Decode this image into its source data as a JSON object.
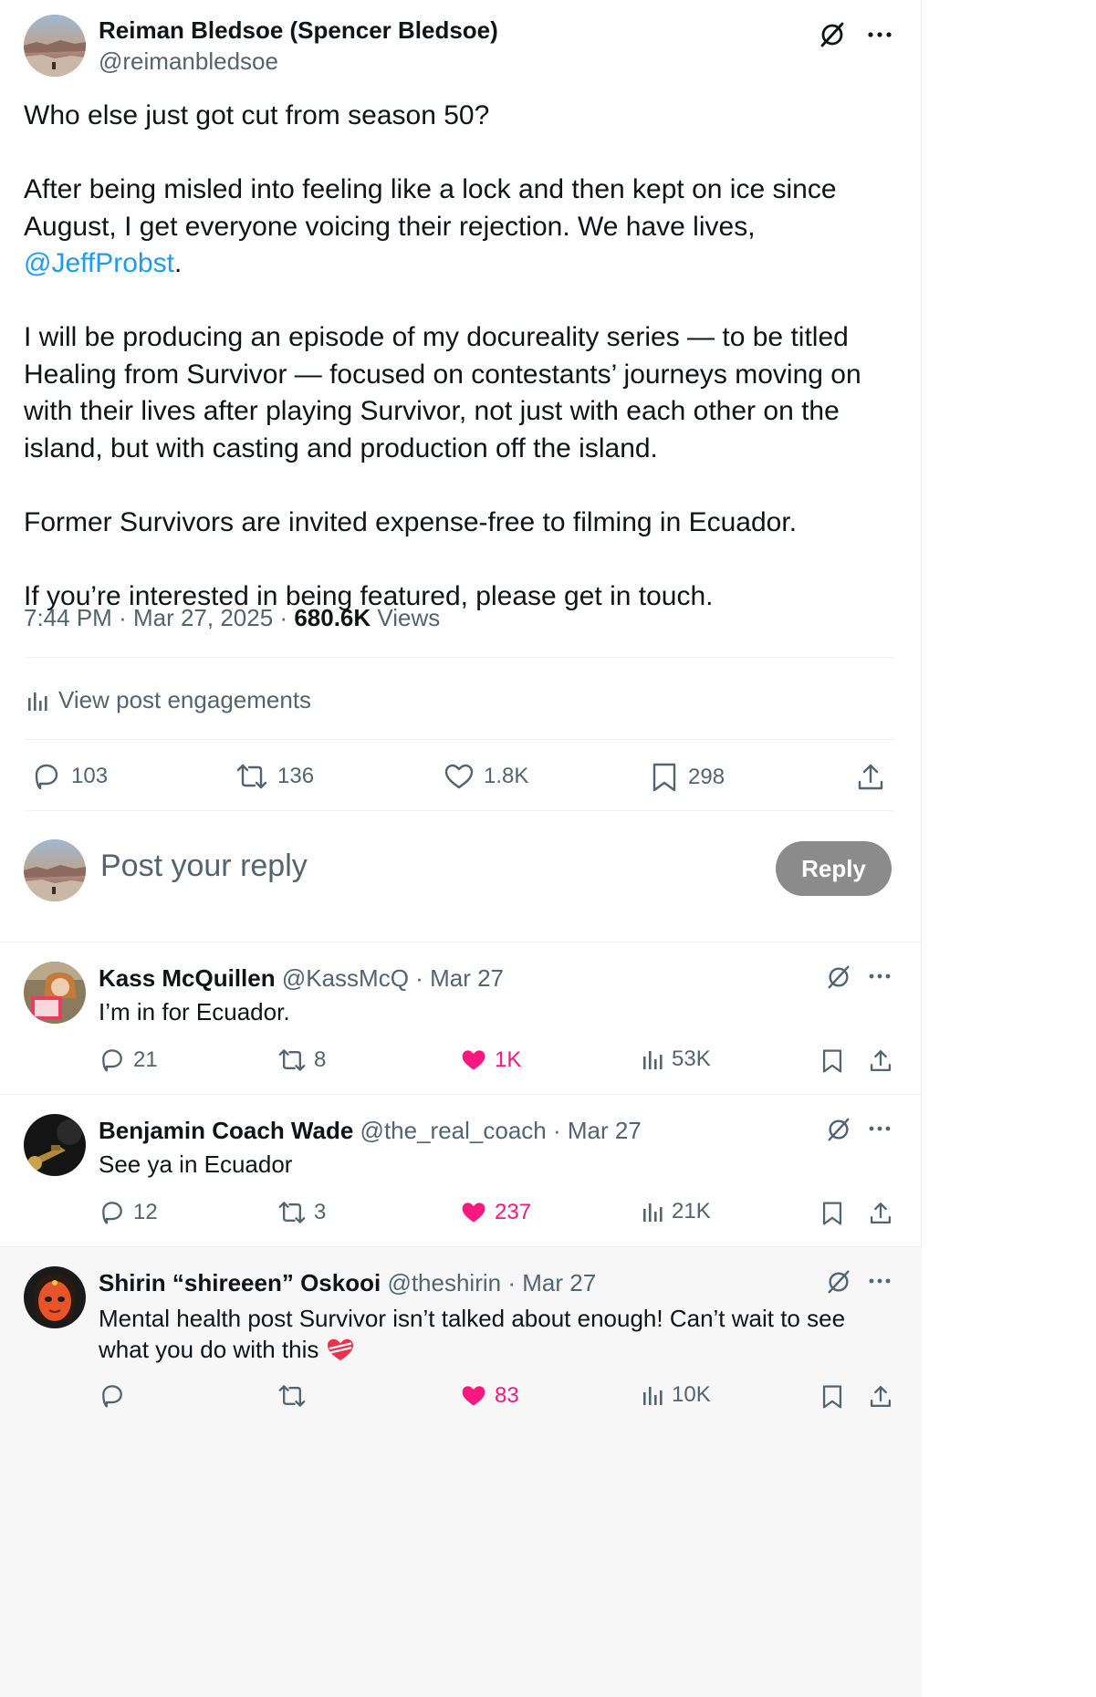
{
  "post": {
    "author_name": "Reiman Bledsoe (Spencer Bledsoe)",
    "author_handle": "@reimanbledsoe",
    "paragraphs": {
      "p1": "Who else just got cut from season 50?",
      "p2_line1": "After being misled into feeling like a lock and then kept on ice since",
      "p2_line2_pre": "August, I get everyone voicing their rejection. We have lives, ",
      "p2_mention": "@JeffProbst",
      "p2_line2_post": ".",
      "p3_line1": "I will be producing an episode of my docureality series — to be titled",
      "p3_line2": "Healing from Survivor — focused on contestants’ journeys moving on",
      "p3_line3": "with their lives after playing Survivor, not just with each other on the",
      "p3_line4": "island, but with casting and production off the island.",
      "p4": "Former Survivors are invited expense-free to filming in Ecuador.",
      "p5": "If you’re interested in being featured, please get in touch."
    },
    "time": "7:44 PM",
    "sep1": "·",
    "date": "Mar 27, 2025",
    "sep2": "·",
    "views_count": "680.6K",
    "views_label": "Views",
    "engagements_label": "View post engagements",
    "stats": {
      "replies": "103",
      "reposts": "136",
      "likes": "1.8K",
      "bookmarks": "298"
    }
  },
  "composer": {
    "placeholder": "Post your reply",
    "reply_button": "Reply"
  },
  "replies": [
    {
      "name": "Kass McQuillen",
      "handle": "@KassMcQ",
      "sep": "·",
      "date": "Mar 27",
      "text": "I’m in for Ecuador.",
      "replies": "21",
      "reposts": "8",
      "likes": "1K",
      "views": "53K"
    },
    {
      "name": "Benjamin Coach Wade",
      "handle": "@the_real_coach",
      "sep": "·",
      "date": "Mar 27",
      "text": "See ya in Ecuador",
      "replies": "12",
      "reposts": "3",
      "likes": "237",
      "views": "21K"
    },
    {
      "name": "Shirin “shireeen” Oskooi",
      "handle": "@theshirin",
      "sep": "·",
      "date": "Mar 27",
      "text_line1": "Mental health post Survivor isn’t talked about enough! Can’t wait to see",
      "text_line2": "what you do with this",
      "likes": "83",
      "views": "10K"
    }
  ],
  "colors": {
    "accent": "#1d9bf0",
    "like_pink": "#f91880",
    "muted": "#536471",
    "reply_button_bg": "#8b8b8b",
    "highlight_bg": "#f7f7f7"
  },
  "icons": [
    "grok-icon",
    "more-icon",
    "reply-icon",
    "repost-icon",
    "like-icon",
    "bookmark-icon",
    "share-icon",
    "analytics-icon",
    "heart-emoji-icon"
  ]
}
